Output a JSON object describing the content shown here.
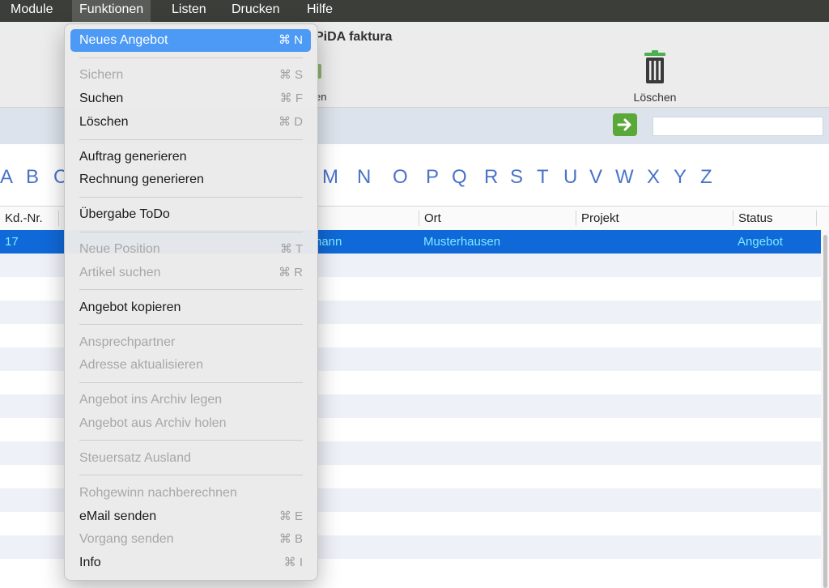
{
  "menubar": {
    "items": [
      "Module",
      "Funktionen",
      "Listen",
      "Drucken",
      "Hilfe"
    ]
  },
  "window": {
    "title": "PiDA faktura",
    "partial_button_label": "en",
    "delete_label": "Löschen"
  },
  "alphabet": [
    "A",
    "B",
    "C",
    "M",
    "N",
    "O",
    "P",
    "Q",
    "R",
    "S",
    "T",
    "U",
    "V",
    "W",
    "X",
    "Y",
    "Z"
  ],
  "table": {
    "headers": [
      "Kd.-Nr.",
      "Ort",
      "Projekt",
      "Status"
    ],
    "selected_row": {
      "kdnr": "17",
      "name_partial": "nann",
      "ort": "Musterhausen",
      "projekt": "",
      "status": "Angebot"
    }
  },
  "dropdown": {
    "items": [
      {
        "label": "Neues Angebot",
        "shortcut": "⌘ N",
        "state": "highlight"
      },
      {
        "label": "Sichern",
        "shortcut": "⌘ S",
        "state": "disabled"
      },
      {
        "label": "Suchen",
        "shortcut": "⌘ F",
        "state": "enabled"
      },
      {
        "label": "Löschen",
        "shortcut": "⌘ D",
        "state": "enabled"
      },
      {
        "label": "Auftrag generieren",
        "shortcut": "",
        "state": "enabled"
      },
      {
        "label": "Rechnung generieren",
        "shortcut": "",
        "state": "enabled"
      },
      {
        "label": "Übergabe ToDo",
        "shortcut": "",
        "state": "enabled"
      },
      {
        "label": "Neue Position",
        "shortcut": "⌘ T",
        "state": "disabled"
      },
      {
        "label": "Artikel suchen",
        "shortcut": "⌘ R",
        "state": "disabled"
      },
      {
        "label": "Angebot kopieren",
        "shortcut": "",
        "state": "enabled"
      },
      {
        "label": "Ansprechpartner",
        "shortcut": "",
        "state": "disabled"
      },
      {
        "label": "Adresse aktualisieren",
        "shortcut": "",
        "state": "disabled"
      },
      {
        "label": "Angebot ins Archiv legen",
        "shortcut": "",
        "state": "disabled"
      },
      {
        "label": "Angebot aus Archiv holen",
        "shortcut": "",
        "state": "disabled"
      },
      {
        "label": "Steuersatz Ausland",
        "shortcut": "",
        "state": "disabled"
      },
      {
        "label": "Rohgewinn nachberechnen",
        "shortcut": "",
        "state": "disabled"
      },
      {
        "label": "eMail senden",
        "shortcut": "⌘ E",
        "state": "enabled"
      },
      {
        "label": "Vorgang senden",
        "shortcut": "⌘ B",
        "state": "disabled"
      },
      {
        "label": "Info",
        "shortcut": "⌘ I",
        "state": "enabled"
      }
    ]
  },
  "colors": {
    "menubar": "#3c3e39",
    "highlight": "#4c9af5",
    "selected_row": "#1069d8",
    "selected_text": "#7fe9ff",
    "alphabet": "#4a73c9",
    "go_button": "#5aa838"
  },
  "icons": {
    "delete": "trash-icon",
    "go": "arrow-right-icon"
  }
}
